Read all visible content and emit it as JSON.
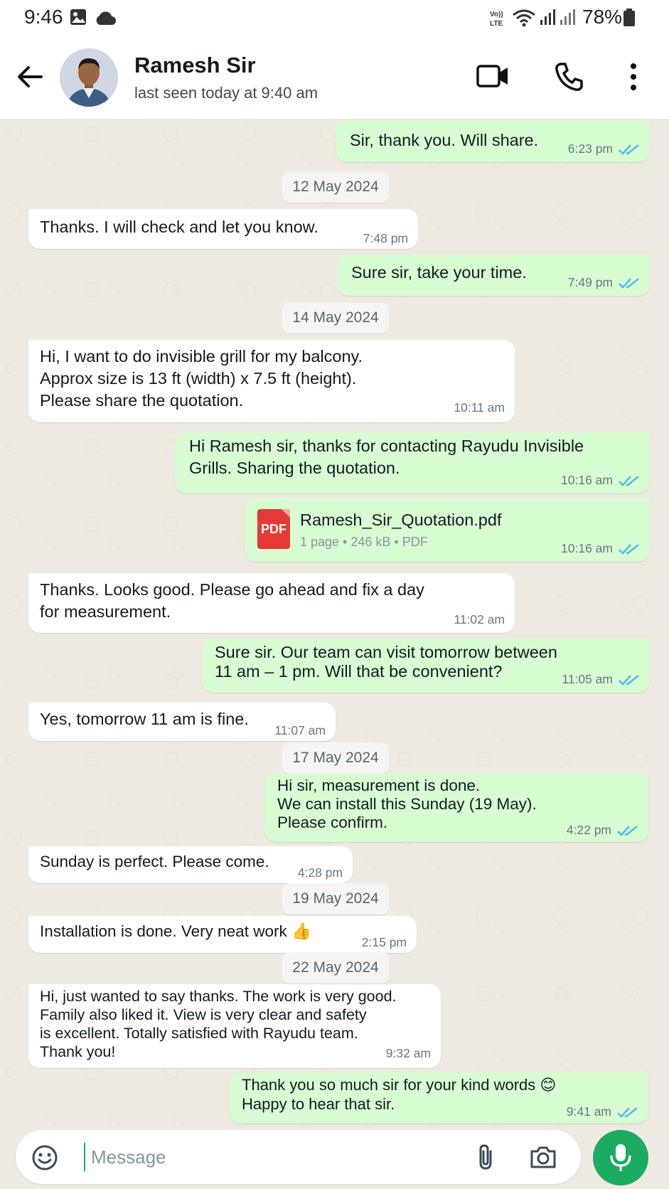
{
  "status_bar": {
    "time": "9:46",
    "battery": "78%"
  },
  "header": {
    "contact_name": "Ramesh Sir",
    "last_seen": "last seen today at 9:40 am"
  },
  "colors": {
    "outgoing_bubble": "#d9fdd3",
    "incoming_bubble": "#ffffff",
    "tick_read": "#53bdeb",
    "mic_button": "#1daa61",
    "pdf_red": "#e53935"
  },
  "messages": [
    {
      "type": "out",
      "text": "Sir, thank you. Will share.",
      "time": "6:23 pm",
      "read": true
    },
    {
      "type": "date",
      "text": "12 May 2024"
    },
    {
      "type": "in",
      "text": "Thanks. I will check and let you know.",
      "time": "7:48 pm"
    },
    {
      "type": "out",
      "text": "Sure sir, take your time.",
      "time": "7:49 pm",
      "read": true
    },
    {
      "type": "date",
      "text": "14 May 2024"
    },
    {
      "type": "in",
      "text": "Hi, I want to do invisible grill for my balcony.\nApprox size is 13 ft (width) x 7.5 ft (height).\nPlease share the quotation.",
      "time": "10:11 am"
    },
    {
      "type": "out",
      "text": "Hi Ramesh sir, thanks for contacting Rayudu Invisible\nGrills. Sharing the quotation.",
      "time": "10:16 am",
      "read": true
    },
    {
      "type": "file",
      "file_name": "Ramesh_Sir_Quotation.pdf",
      "file_info": "1 page • 246 kB • PDF",
      "icon_label": "PDF",
      "time": "10:16 am",
      "read": true
    },
    {
      "type": "in",
      "text": "Thanks. Looks good. Please go ahead and fix a day\nfor measurement.",
      "time": "11:02 am"
    },
    {
      "type": "out",
      "text": "Sure sir. Our team can visit tomorrow between\n11 am – 1 pm. Will that be convenient?",
      "time": "11:05 am",
      "read": true
    },
    {
      "type": "in",
      "text": "Yes, tomorrow 11 am is fine.",
      "time": "11:07 am"
    },
    {
      "type": "date",
      "text": "17 May 2024"
    },
    {
      "type": "out",
      "text": "Hi sir, measurement is done.\nWe can install this Sunday (19 May).\nPlease confirm.",
      "time": "4:22 pm",
      "read": true
    },
    {
      "type": "in",
      "text": "Sunday is perfect. Please come.",
      "time": "4:28 pm"
    },
    {
      "type": "date",
      "text": "19 May 2024"
    },
    {
      "type": "in",
      "text": "Installation is done. Very neat work 👍",
      "time": "2:15 pm"
    },
    {
      "type": "date",
      "text": "22 May 2024"
    },
    {
      "type": "in",
      "text": "Hi, just wanted to say thanks. The work is very good.\nFamily also liked it. View is very clear and safety\nis excellent. Totally satisfied with Rayudu team.\nThank you!",
      "time": "9:32 am"
    },
    {
      "type": "out",
      "text": "Thank you so much sir for your kind words 😊\nHappy to hear that sir.",
      "time": "9:41 am",
      "read": true
    }
  ],
  "composer": {
    "placeholder": "Message"
  },
  "icons": [
    "image-icon",
    "cloud-icon",
    "volte-icon",
    "wifi-icon",
    "signal-icon",
    "battery-icon",
    "back-arrow-icon",
    "video-call-icon",
    "voice-call-icon",
    "more-options-icon",
    "double-tick-icon",
    "pdf-icon",
    "emoji-icon",
    "attach-icon",
    "camera-icon",
    "mic-icon"
  ]
}
